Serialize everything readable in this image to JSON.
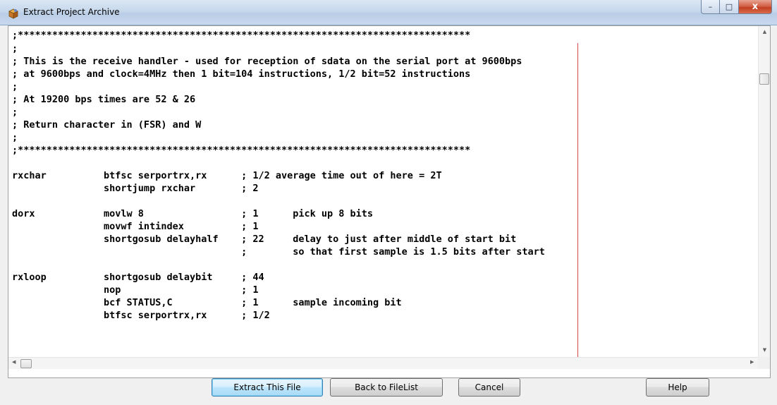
{
  "window": {
    "title": "Extract Project Archive",
    "controls": {
      "minimize": "–",
      "maximize": "□",
      "close": "x"
    }
  },
  "code_lines": [
    ";*******************************************************************************",
    ";",
    "; This is the receive handler - used for reception of sdata on the serial port at 9600bps",
    "; at 9600bps and clock=4MHz then 1 bit=104 instructions, 1/2 bit=52 instructions",
    ";",
    "; At 19200 bps times are 52 & 26",
    ";",
    "; Return character in (FSR) and W",
    ";",
    ";*******************************************************************************",
    "",
    "rxchar          btfsc serportrx,rx      ; 1/2 average time out of here = 2T",
    "                shortjump rxchar        ; 2",
    "",
    "dorx            movlw 8                 ; 1      pick up 8 bits",
    "                movwf intindex          ; 1",
    "                shortgosub delayhalf    ; 22     delay to just after middle of start bit",
    "                                        ;        so that first sample is 1.5 bits after start",
    "",
    "rxloop          shortgosub delaybit     ; 44",
    "                nop                     ; 1",
    "                bcf STATUS,C            ; 1      sample incoming bit",
    "                btfsc serportrx,rx      ; 1/2"
  ],
  "buttons": {
    "extract": "Extract This File",
    "back": "Back to FileList",
    "cancel": "Cancel",
    "help": "Help"
  },
  "colors": {
    "margin_line": "#d24a4a",
    "default_button_border": "#3c7fb1"
  },
  "icons": {
    "app": "archive-icon",
    "scroll_up": "arrow-up-icon",
    "scroll_down": "arrow-down-icon",
    "scroll_left": "arrow-left-icon",
    "scroll_right": "arrow-right-icon"
  }
}
